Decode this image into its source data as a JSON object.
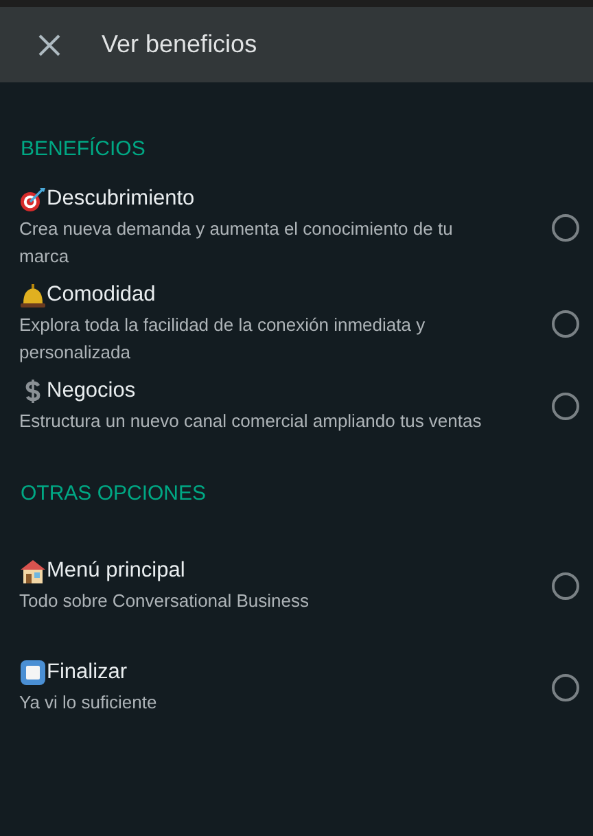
{
  "header": {
    "title": "Ver beneficios"
  },
  "sections": [
    {
      "heading": "BENEFÍCIOS",
      "options": [
        {
          "kind": "target",
          "title": "Descubrimiento",
          "description": "Crea nueva demanda y aumenta el conocimiento de tu marca",
          "selected": false
        },
        {
          "kind": "bell",
          "title": "Comodidad",
          "description": "Explora toda la facilidad de la conexión inmediata y personalizada",
          "selected": false
        },
        {
          "kind": "dollar",
          "title": "Negocios",
          "description": "Estructura un nuevo canal comercial ampliando tus ventas",
          "selected": false
        }
      ]
    },
    {
      "heading": "OTRAS OPCIONES",
      "options": [
        {
          "kind": "house",
          "title": "Menú principal",
          "description": "Todo sobre Conversational Business",
          "selected": false
        },
        {
          "kind": "stop",
          "title": "Finalizar",
          "description": "Ya vi lo suficiente",
          "selected": false
        }
      ]
    }
  ]
}
